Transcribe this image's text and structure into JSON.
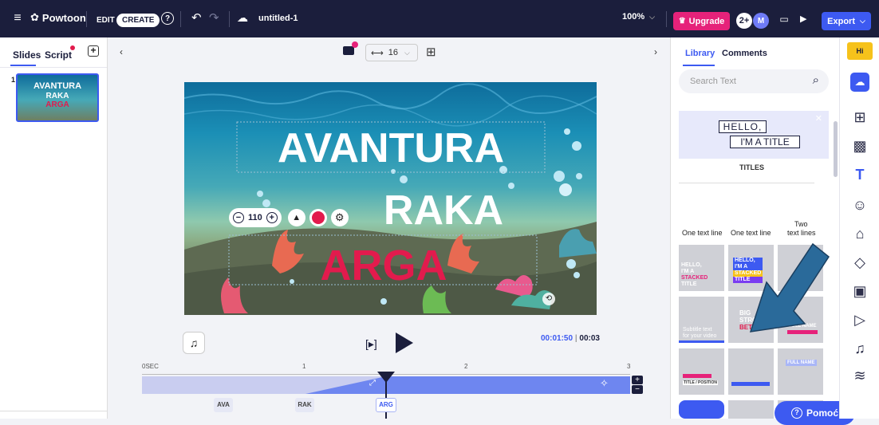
{
  "app": {
    "brand": "Powtoon",
    "mode_edit": "EDIT",
    "mode_create": "CREATE",
    "file_name": "untitled-1",
    "zoom": "100%",
    "upgrade_label": "Upgrade",
    "avatar_initial": "M",
    "export_label": "Export"
  },
  "sidebar": {
    "tab_slides": "Slides",
    "tab_script": "Script",
    "slide_number": "1",
    "thumb_line1": "AVANTURA",
    "thumb_line2": "RAKA",
    "thumb_line3": "ARGA"
  },
  "subbar": {
    "grid_value": "16"
  },
  "stage": {
    "title_line1": "AVANTURA",
    "title_line2": "RAKA",
    "title_line3": "ARGA",
    "font_size_value": "110",
    "accent_text_color": "#e21b4d"
  },
  "playback": {
    "current_time": "00:01:50",
    "total_time": "00:03",
    "ruler_start": "0SEC",
    "ruler_1": "1",
    "ruler_2": "2",
    "ruler_3": "3",
    "clips": [
      "AVA",
      "RAK",
      "ARG"
    ]
  },
  "library": {
    "tab_library": "Library",
    "tab_comments": "Comments",
    "search_placeholder": "Search Text",
    "hero_line1": "HELLO,",
    "hero_line2": "I'M A TITLE",
    "section_label": "TITLES",
    "col1": "One text line",
    "col2": "One text line",
    "col3_line1": "Two",
    "col3_line2": "text lines",
    "t1_lines": [
      "HELLO,",
      "I'M A",
      "STACKED",
      "TITLE"
    ],
    "t2_lines": [
      "HELLO,",
      "I'M A",
      "STACKED",
      "TITLE"
    ],
    "t4_lines": [
      "Subtitle text",
      "for your video"
    ],
    "t5_lines": [
      "BIG",
      "STRONG",
      "BETTER"
    ],
    "t6_line": "FULL NAME",
    "t7_line": "TITLE / POSITION",
    "t8_line": "FULL NAME",
    "help_label": "Pomoć"
  },
  "colors": {
    "topbar": "#1b1e3c",
    "accent_blue": "#3d5af1",
    "upgrade_pink": "#e6227a",
    "arrow_blue": "#2a6a9a"
  }
}
